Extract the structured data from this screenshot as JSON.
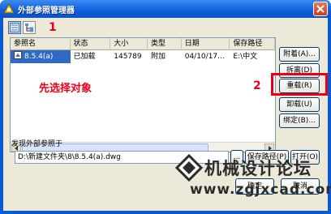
{
  "window": {
    "title": "外部参照管理器"
  },
  "annotations": {
    "marker_1": "1",
    "marker_2": "2",
    "instruction": "先选择对象"
  },
  "list": {
    "columns": [
      "参照名",
      "状态",
      "大小",
      "类型",
      "日期",
      "保存路径"
    ],
    "rows": [
      {
        "name": "8.5.4(a)",
        "status": "已加载",
        "size": "145789",
        "type": "附加",
        "date": "04/10/17...",
        "path": "E:\\中文"
      }
    ]
  },
  "actions": {
    "attach": "附着(A)...",
    "detach": "拆离(D)",
    "reload": "重载(R)",
    "unload": "卸载(U)",
    "bind": "绑定(B)..."
  },
  "found_at": {
    "label": "发现外部参照于",
    "path": "D:\\新建文件夹\\8\\8.5.4(a).dwg",
    "browse": "...",
    "save_path": "保存路径(P)",
    "open": "打开(O)"
  },
  "dialog_buttons": {
    "ok": "确定",
    "cancel": "取消"
  },
  "watermark": {
    "line1": "机械设计论坛",
    "line2": "www.zgjxcad.com"
  },
  "colors": {
    "accent": "#e8001a",
    "selection": "#316ac5",
    "titlebar": "#1160e0"
  },
  "icons": [
    "app-icon",
    "list-view-icon",
    "tree-view-icon",
    "close-icon",
    "xref-drawing-icon"
  ]
}
